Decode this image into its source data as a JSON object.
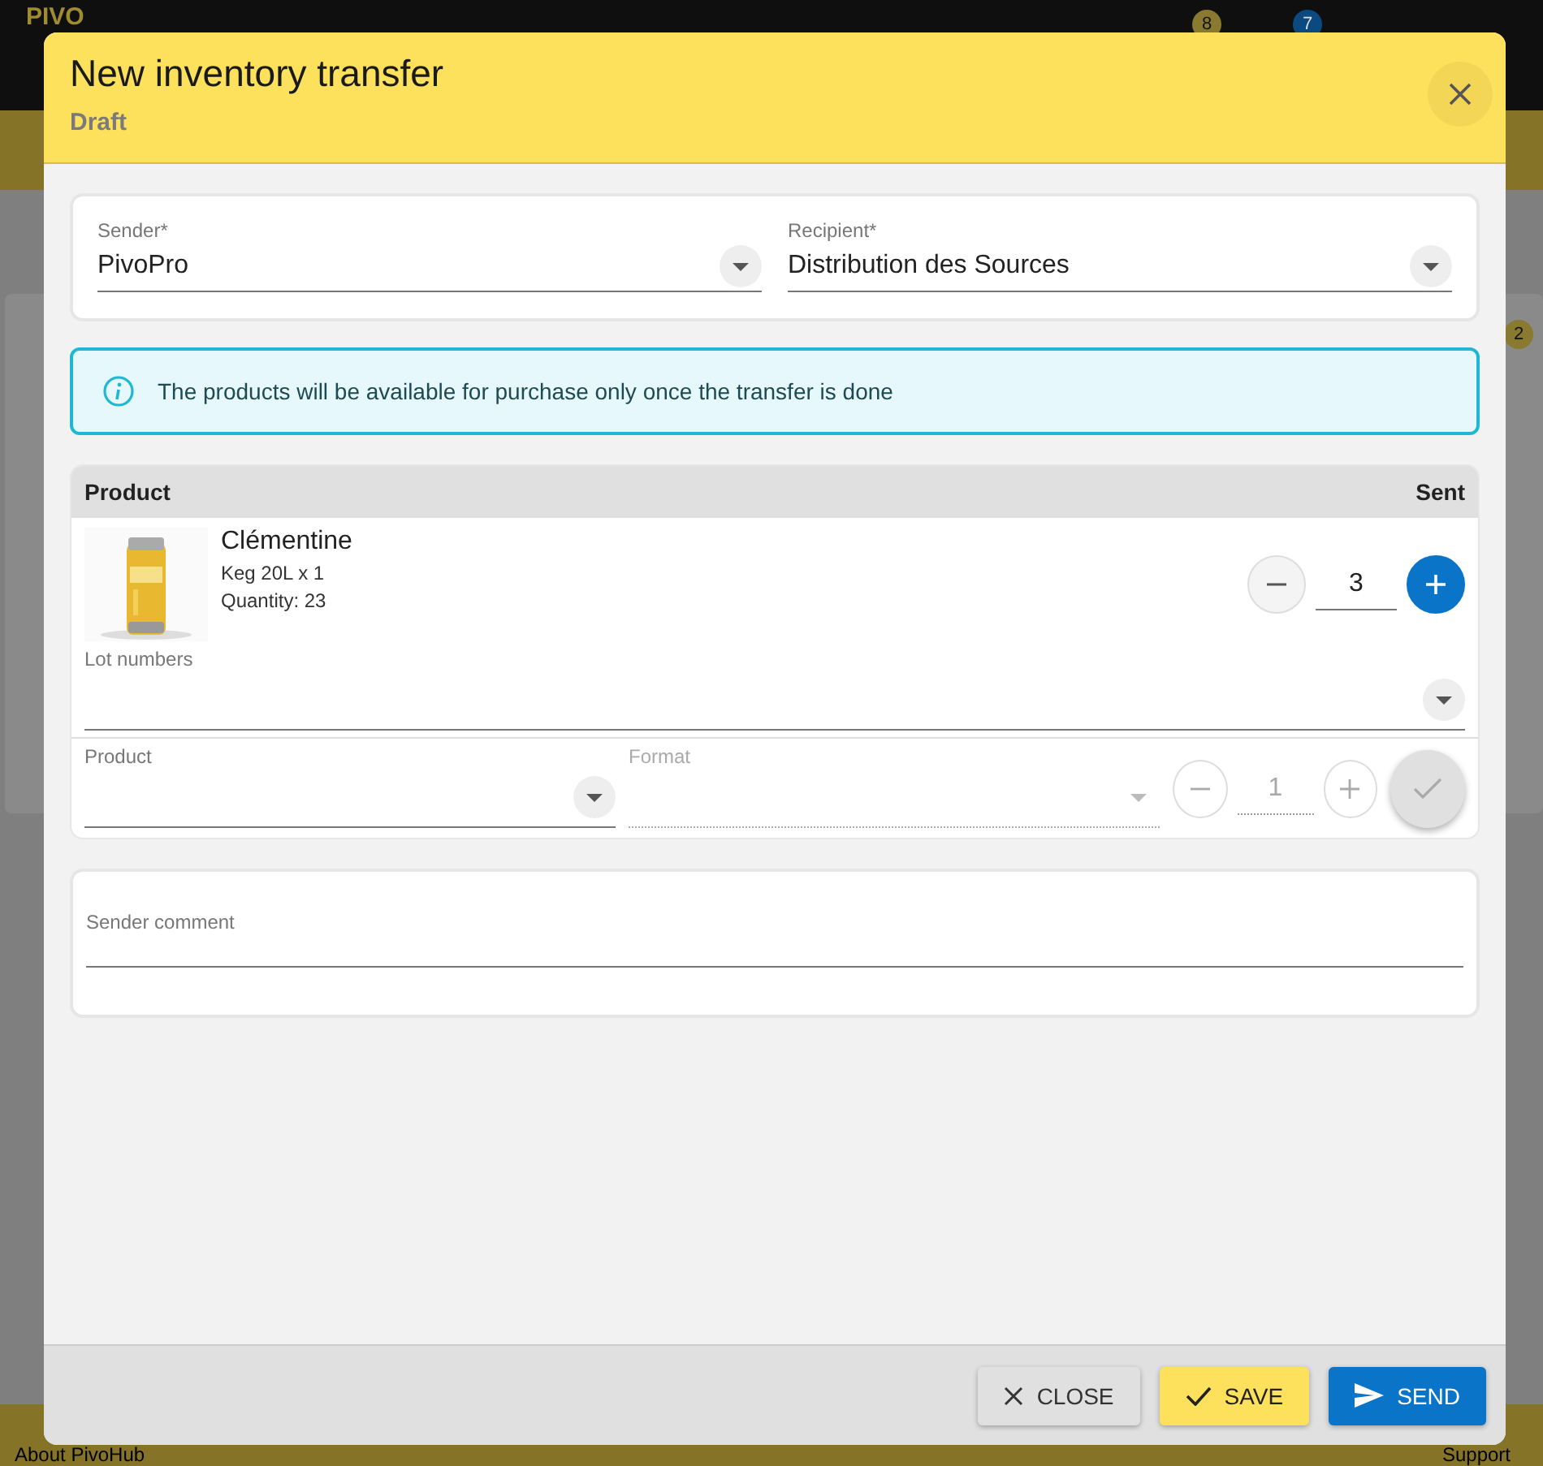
{
  "background": {
    "logo": "PIVO",
    "badges": [
      {
        "count": "8",
        "color": "#8a7a30"
      },
      {
        "count": "7",
        "color": "#0b4a80"
      },
      {
        "count": "2",
        "color": "#8a7a30"
      }
    ],
    "footer_links": [
      "About PivoHub",
      "Support"
    ]
  },
  "dialog": {
    "title": "New inventory transfer",
    "status": "Draft",
    "sender": {
      "label": "Sender*",
      "value": "PivoPro"
    },
    "recipient": {
      "label": "Recipient*",
      "value": "Distribution des Sources"
    },
    "info": "The products will be available for purchase only once the transfer is done",
    "table": {
      "columns": [
        "Product",
        "Sent"
      ],
      "rows": [
        {
          "name": "Clémentine",
          "format": "Keg 20L x 1",
          "quantity": "Quantity: 23",
          "sent": "3",
          "lot_label": "Lot numbers"
        }
      ]
    },
    "add_row": {
      "product_label": "Product",
      "format_label": "Format",
      "format_disabled": true,
      "quantity": "1",
      "confirm_disabled": true
    },
    "comment": {
      "label": "Sender comment"
    },
    "buttons": [
      {
        "kind": "close",
        "label": "CLOSE"
      },
      {
        "kind": "save",
        "label": "SAVE"
      },
      {
        "kind": "send",
        "label": "SEND"
      }
    ]
  }
}
